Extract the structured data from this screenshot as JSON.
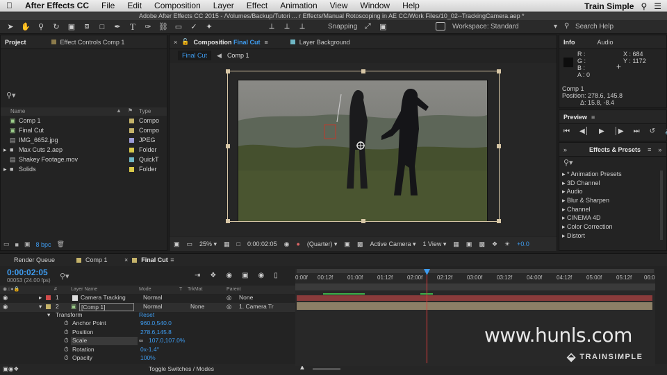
{
  "menubar": {
    "app_name": "After Effects CC",
    "items": [
      "File",
      "Edit",
      "Composition",
      "Layer",
      "Effect",
      "Animation",
      "View",
      "Window",
      "Help"
    ],
    "right_label": "Train Simple"
  },
  "window_title": "Adobe After Effects CC 2015 - /Volumes/Backup/Tutori ... r Effects/Manual Rotoscoping in AE CC/Work Files/10_02--TrackingCamera.aep *",
  "toolbar": {
    "snapping_label": "Snapping",
    "workspace_label": "Workspace:",
    "workspace_value": "Standard",
    "search_placeholder": "Search Help"
  },
  "project": {
    "tab_label": "Project",
    "effect_controls_label": "Effect Controls Comp 1",
    "search_placeholder": "",
    "col_name": "Name",
    "col_type": "Type",
    "items": [
      {
        "name": "Comp 1",
        "type": "Compo",
        "label_color": "#c5b36a"
      },
      {
        "name": "Final Cut",
        "type": "Compo",
        "label_color": "#c5b36a"
      },
      {
        "name": "IMG_6652.jpg",
        "type": "JPEG",
        "label_color": "#9b9bd6"
      },
      {
        "name": "Max Cuts 2.aep",
        "type": "Folder",
        "label_color": "#d9c94a"
      },
      {
        "name": "Shakey Footage.mov",
        "type": "QuickT",
        "label_color": "#6fb7c5"
      },
      {
        "name": "Solids",
        "type": "Folder",
        "label_color": "#d9c94a"
      }
    ],
    "bpc": "8 bpc"
  },
  "composition": {
    "tab_label": "Composition",
    "tab_comp_name": "Final Cut",
    "layer_tab_label": "Layer Background",
    "sub_tabs": [
      "Final Cut",
      "Comp 1"
    ],
    "zoom": "25%",
    "timecode": "0:00:02:05",
    "resolution": "(Quarter)",
    "camera": "Active Camera",
    "views": "1 View",
    "offset": "+0.0"
  },
  "info": {
    "tab_label": "Info",
    "audio_tab": "Audio",
    "r": "R :",
    "g": "G :",
    "b": "B :",
    "a": "A : 0",
    "x": "X : 684",
    "y": "Y : 1172",
    "layer": "Comp 1",
    "position": "Position: 278.6, 145.8",
    "delta": "Δ: 15.8, -8.4"
  },
  "preview": {
    "tab_label": "Preview"
  },
  "effects": {
    "tab_label": "Effects & Presets",
    "items": [
      "* Animation Presets",
      "3D Channel",
      "Audio",
      "Blur & Sharpen",
      "Channel",
      "CINEMA 4D",
      "Color Correction",
      "Distort"
    ]
  },
  "timeline": {
    "tabs": [
      "Render Queue",
      "Comp 1",
      "Final Cut"
    ],
    "timecode": "0:00:02:05",
    "fps": "00053 (24.00 fps)",
    "col_layer": "Layer Name",
    "col_mode": "Mode",
    "col_t": "T",
    "col_trkmat": "TrkMat",
    "col_parent": "Parent",
    "layers": [
      {
        "num": "1",
        "name": "Camera Tracking",
        "mode": "Normal",
        "trkmat": "",
        "parent": "None",
        "color": "#d14b4b"
      },
      {
        "num": "2",
        "name": "[Comp 1]",
        "mode": "Normal",
        "trkmat": "None",
        "parent": "1. Camera Tr",
        "color": "#c5b36a"
      }
    ],
    "transform": {
      "label": "Transform",
      "reset": "Reset"
    },
    "props": [
      {
        "name": "Anchor Point",
        "value": "960.0,540.0"
      },
      {
        "name": "Position",
        "value": "278.6,145.8"
      },
      {
        "name": "Scale",
        "value": "107.0,107.0%"
      },
      {
        "name": "Rotation",
        "value": "0x-1.4°"
      },
      {
        "name": "Opacity",
        "value": "100%"
      }
    ],
    "toggle_label": "Toggle Switches / Modes",
    "ruler": [
      "0:00f",
      "00:12f",
      "01:00f",
      "01:12f",
      "02:00f",
      "02:12f",
      "03:00f",
      "03:12f",
      "04:00f",
      "04:12f",
      "05:00f",
      "05:12f",
      "06:0"
    ]
  },
  "watermark": "www.hunls.com",
  "brand": "TRAINSIMPLE"
}
